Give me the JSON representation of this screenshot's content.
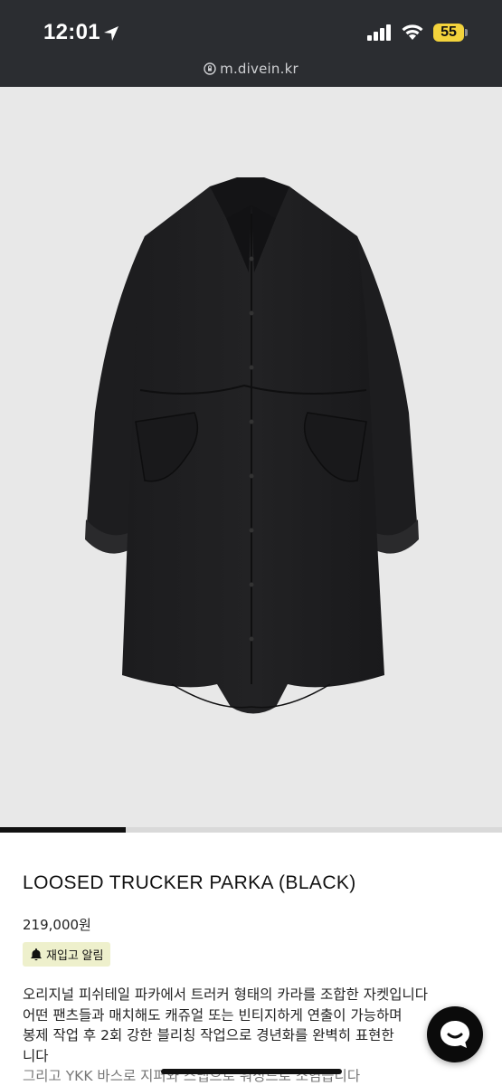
{
  "status_bar": {
    "time": "12:01",
    "battery": "55",
    "icons": [
      "location-arrow-icon",
      "cellular-signal-icon",
      "wifi-icon",
      "battery-icon"
    ]
  },
  "browser": {
    "url": "m.divein.kr"
  },
  "product": {
    "image_alt_icon": "parka-photo",
    "gallery_progress": 0.25,
    "title": "LOOSED TRUCKER PARKA (BLACK)",
    "price": "219,000원",
    "restock_label": "재입고 알림",
    "description_lines": [
      "오리지널 피쉬테일 파카에서 트러커 형태의 카라를 조합한 자켓입니다",
      "어떤 팬츠들과 매치해도 캐쥬얼 또는 빈티지하게 연출이 가능하며",
      "봉제 작업 후 2회 강한 블리칭 작업으로 경년화를 완벽히 표현한",
      "니다",
      "그리고 YKK 바스로 지퍼와 스냅으로 워싱드로 소염습니다"
    ]
  },
  "colors": {
    "status_bg": "#2b2d31",
    "battery_yellow": "#f3d33c",
    "hero_bg": "#e8e8e8",
    "restock_bg": "#eef0cc",
    "chat_bg": "#0b0b0b"
  }
}
